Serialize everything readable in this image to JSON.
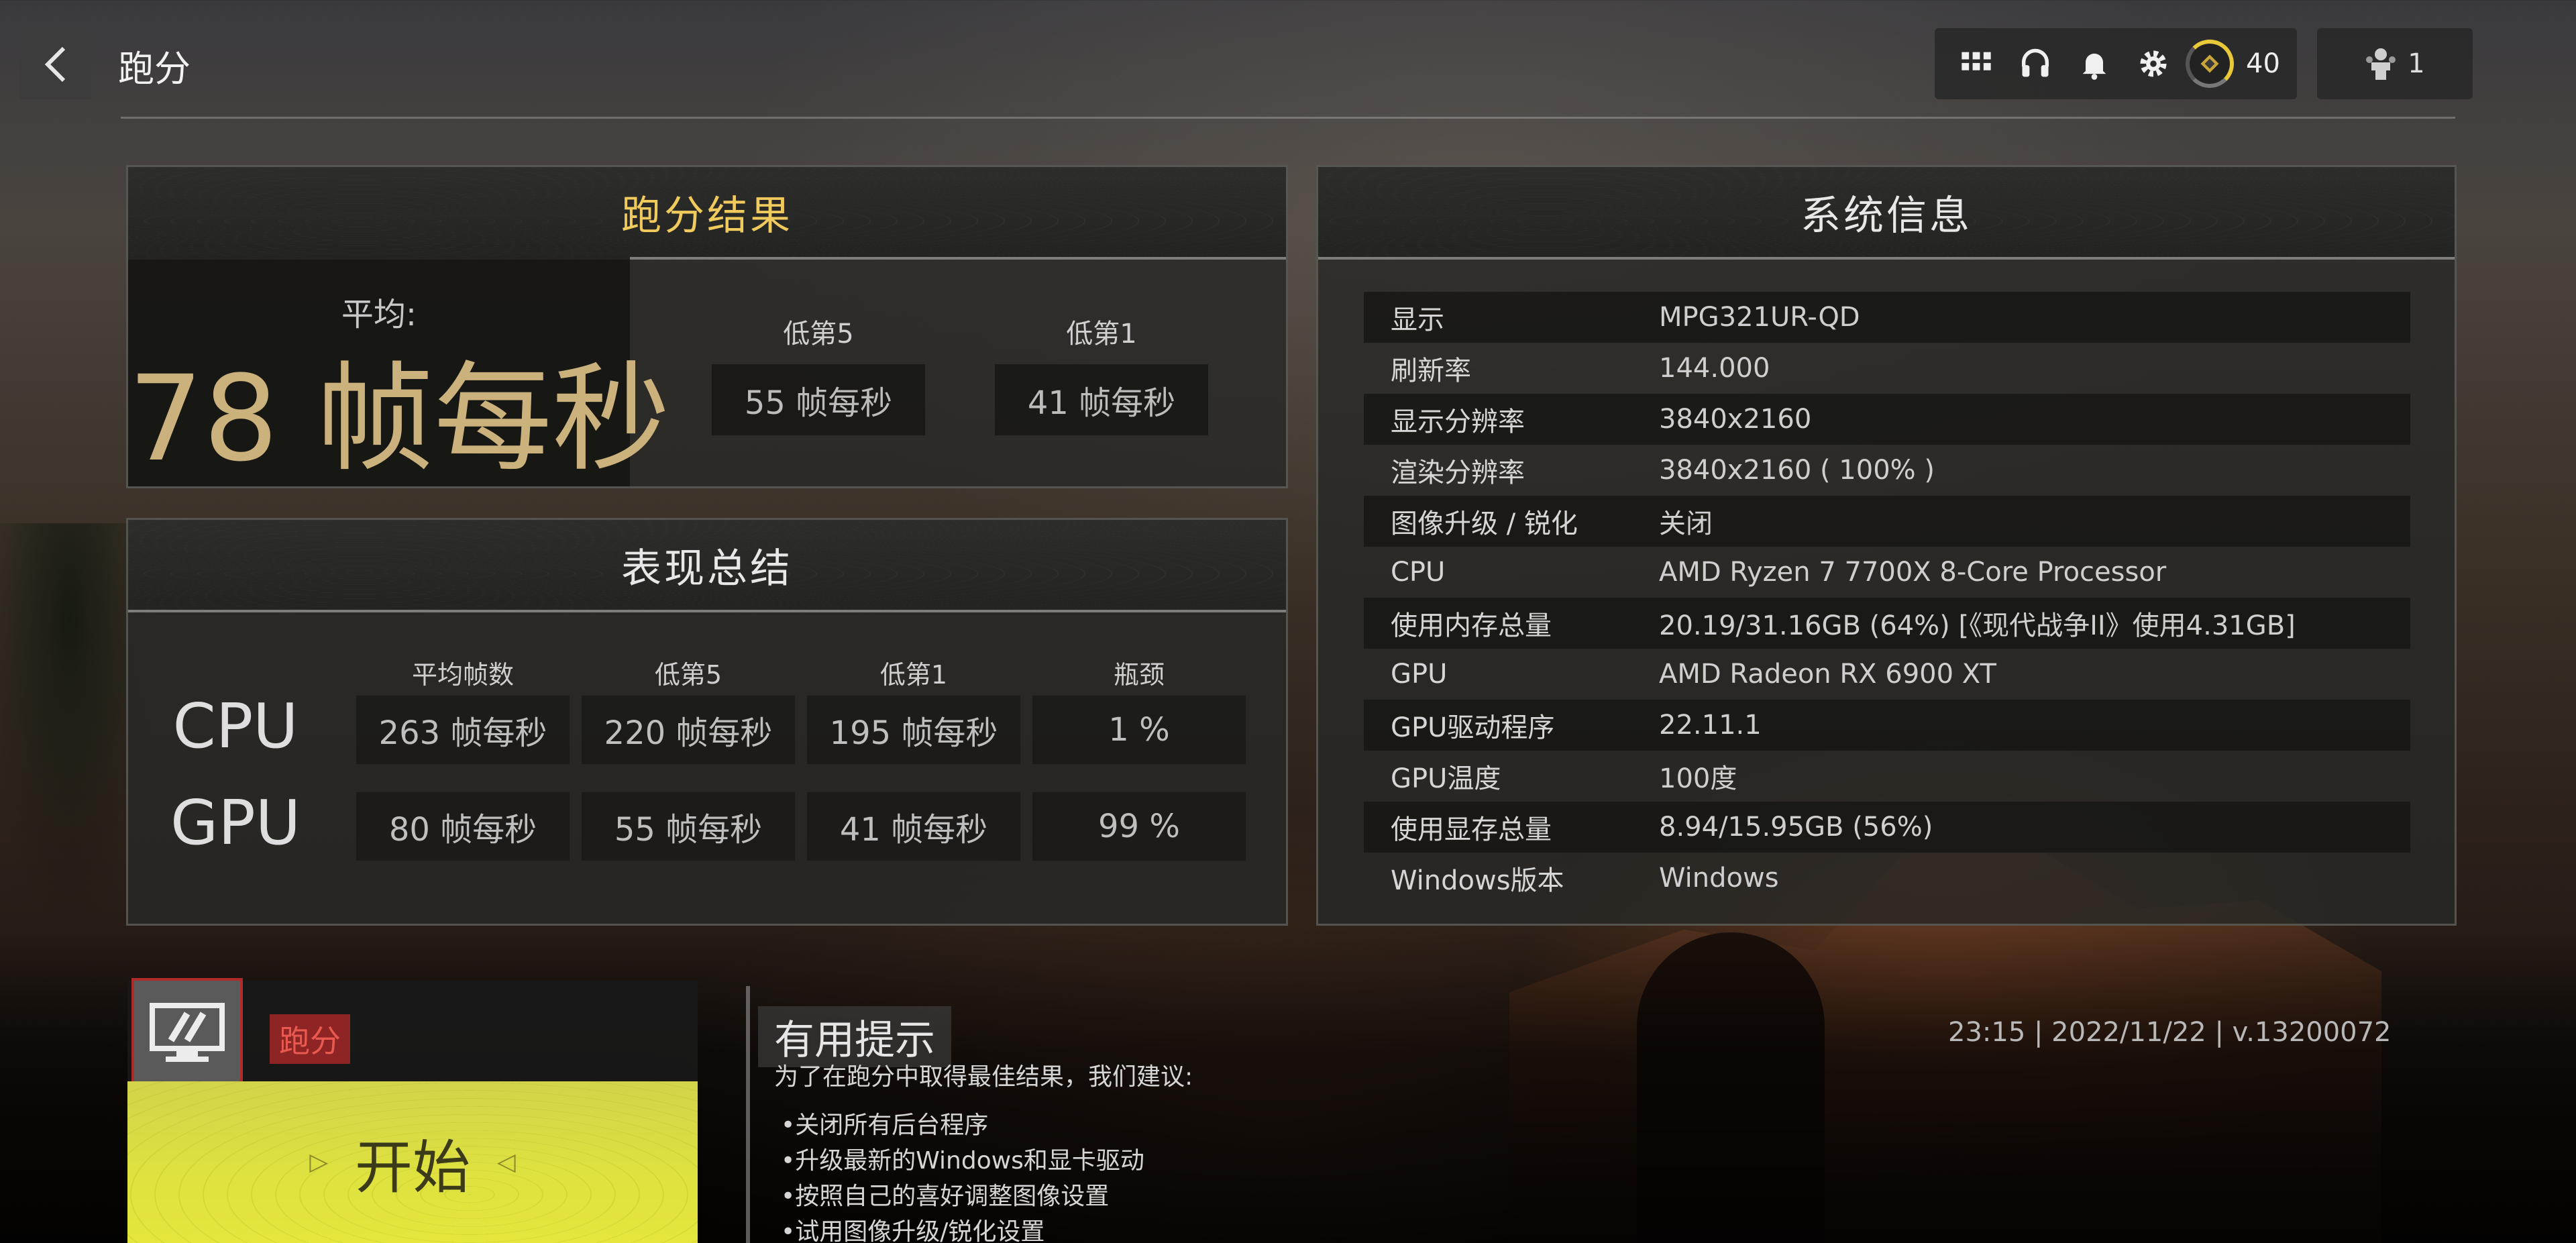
{
  "page_title": "跑分",
  "toolbar": {
    "rank_level": "40",
    "squad_count": "1"
  },
  "results": {
    "title": "跑分结果",
    "avg_label": "平均:",
    "avg_value": "78 帧每秒",
    "low5_label": "低第5",
    "low5_value": "55 帧每秒",
    "low1_label": "低第1",
    "low1_value": "41 帧每秒"
  },
  "summary": {
    "title": "表现总结",
    "headers": [
      "平均帧数",
      "低第5",
      "低第1",
      "瓶颈"
    ],
    "rows": [
      {
        "label": "CPU",
        "values": [
          "263 帧每秒",
          "220 帧每秒",
          "195 帧每秒",
          "1 %"
        ]
      },
      {
        "label": "GPU",
        "values": [
          "80 帧每秒",
          "55 帧每秒",
          "41 帧每秒",
          "99 %"
        ]
      }
    ]
  },
  "sysinfo": {
    "title": "系统信息",
    "rows": [
      {
        "key": "显示",
        "value": "MPG321UR-QD"
      },
      {
        "key": "刷新率",
        "value": "144.000"
      },
      {
        "key": "显示分辨率",
        "value": "3840x2160"
      },
      {
        "key": "渲染分辨率",
        "value": "3840x2160 ( 100% )"
      },
      {
        "key": "图像升级 / 锐化",
        "value": "关闭"
      },
      {
        "key": "CPU",
        "value": "AMD Ryzen 7 7700X 8-Core Processor"
      },
      {
        "key": "使用内存总量",
        "value": "20.19/31.16GB (64%) [《现代战争II》使用4.31GB]"
      },
      {
        "key": "GPU",
        "value": "AMD Radeon RX 6900 XT"
      },
      {
        "key": "GPU驱动程序",
        "value": "22.11.1"
      },
      {
        "key": "GPU温度",
        "value": "100度"
      },
      {
        "key": "使用显存总量",
        "value": "8.94/15.95GB (56%)"
      },
      {
        "key": "Windows版本",
        "value": "Windows"
      }
    ]
  },
  "start": {
    "mode_badge": "跑分",
    "button_label": "开始"
  },
  "tips": {
    "title": "有用提示",
    "intro": "为了在跑分中取得最佳结果，我们建议:",
    "items": [
      "•关闭所有后台程序",
      "•升级最新的Windows和显卡驱动",
      "•按照自己的喜好调整图像设置",
      "•试用图像升级/锐化设置"
    ]
  },
  "version_info": "23:15 | 2022/11/22 | v.13200072",
  "colors": {
    "accent_gold": "#f0ca5c",
    "avg_value": "#cbb27d",
    "start_button": "#dfe23f",
    "mode_badge": "#8e2424"
  }
}
